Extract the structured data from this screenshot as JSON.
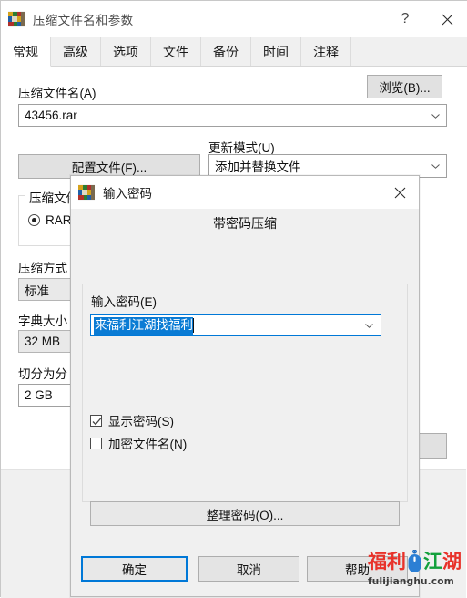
{
  "main_window": {
    "title": "压缩文件名和参数",
    "icon": "winrar-books-icon",
    "titlebar_buttons": {
      "help": "?",
      "close": "close-icon"
    },
    "tabs": [
      {
        "label": "常规",
        "active": true
      },
      {
        "label": "高级",
        "active": false
      },
      {
        "label": "选项",
        "active": false
      },
      {
        "label": "文件",
        "active": false
      },
      {
        "label": "备份",
        "active": false
      },
      {
        "label": "时间",
        "active": false
      },
      {
        "label": "注释",
        "active": false
      }
    ],
    "archive_name_label": "压缩文件名(A)",
    "archive_name_value": "43456.rar",
    "browse_button": "浏览(B)...",
    "profiles_button": "配置文件(F)...",
    "update_mode_label": "更新模式(U)",
    "update_mode_value": "添加并替换文件",
    "archive_format_group": "压缩文件格",
    "format_rar_label": "RAR",
    "format_rar_selected": true,
    "compression_method_label": "压缩方式",
    "compression_method_value": "标准",
    "dictionary_size_label": "字典大小",
    "dictionary_size_value": "32 MB",
    "split_volumes_label": "切分为分",
    "split_volumes_value": "2 GB"
  },
  "modal": {
    "title": "输入密码",
    "icon": "winrar-books-icon",
    "close_icon": "close-icon",
    "heading": "带密码压缩",
    "password_label": "输入密码(E)",
    "password_value": "来福利江湖找福利",
    "password_selected": true,
    "show_password_label": "显示密码(S)",
    "show_password_checked": true,
    "encrypt_filenames_label": "加密文件名(N)",
    "encrypt_filenames_checked": false,
    "organize_passwords_button": "整理密码(O)...",
    "ok_button": "确定",
    "cancel_button": "取消",
    "help_button": "帮助"
  },
  "watermark": {
    "part1": "福利",
    "part2": "江湖",
    "url": "fulijianghu.com",
    "mouse_icon": "mouse-icon",
    "color_red": "#e8322a",
    "color_green": "#13a03c",
    "color_blue": "#1f6fc4"
  },
  "colors": {
    "accent": "#0078d7",
    "window_bg": "#f0f0f0",
    "selection": "#0a7bd4"
  }
}
